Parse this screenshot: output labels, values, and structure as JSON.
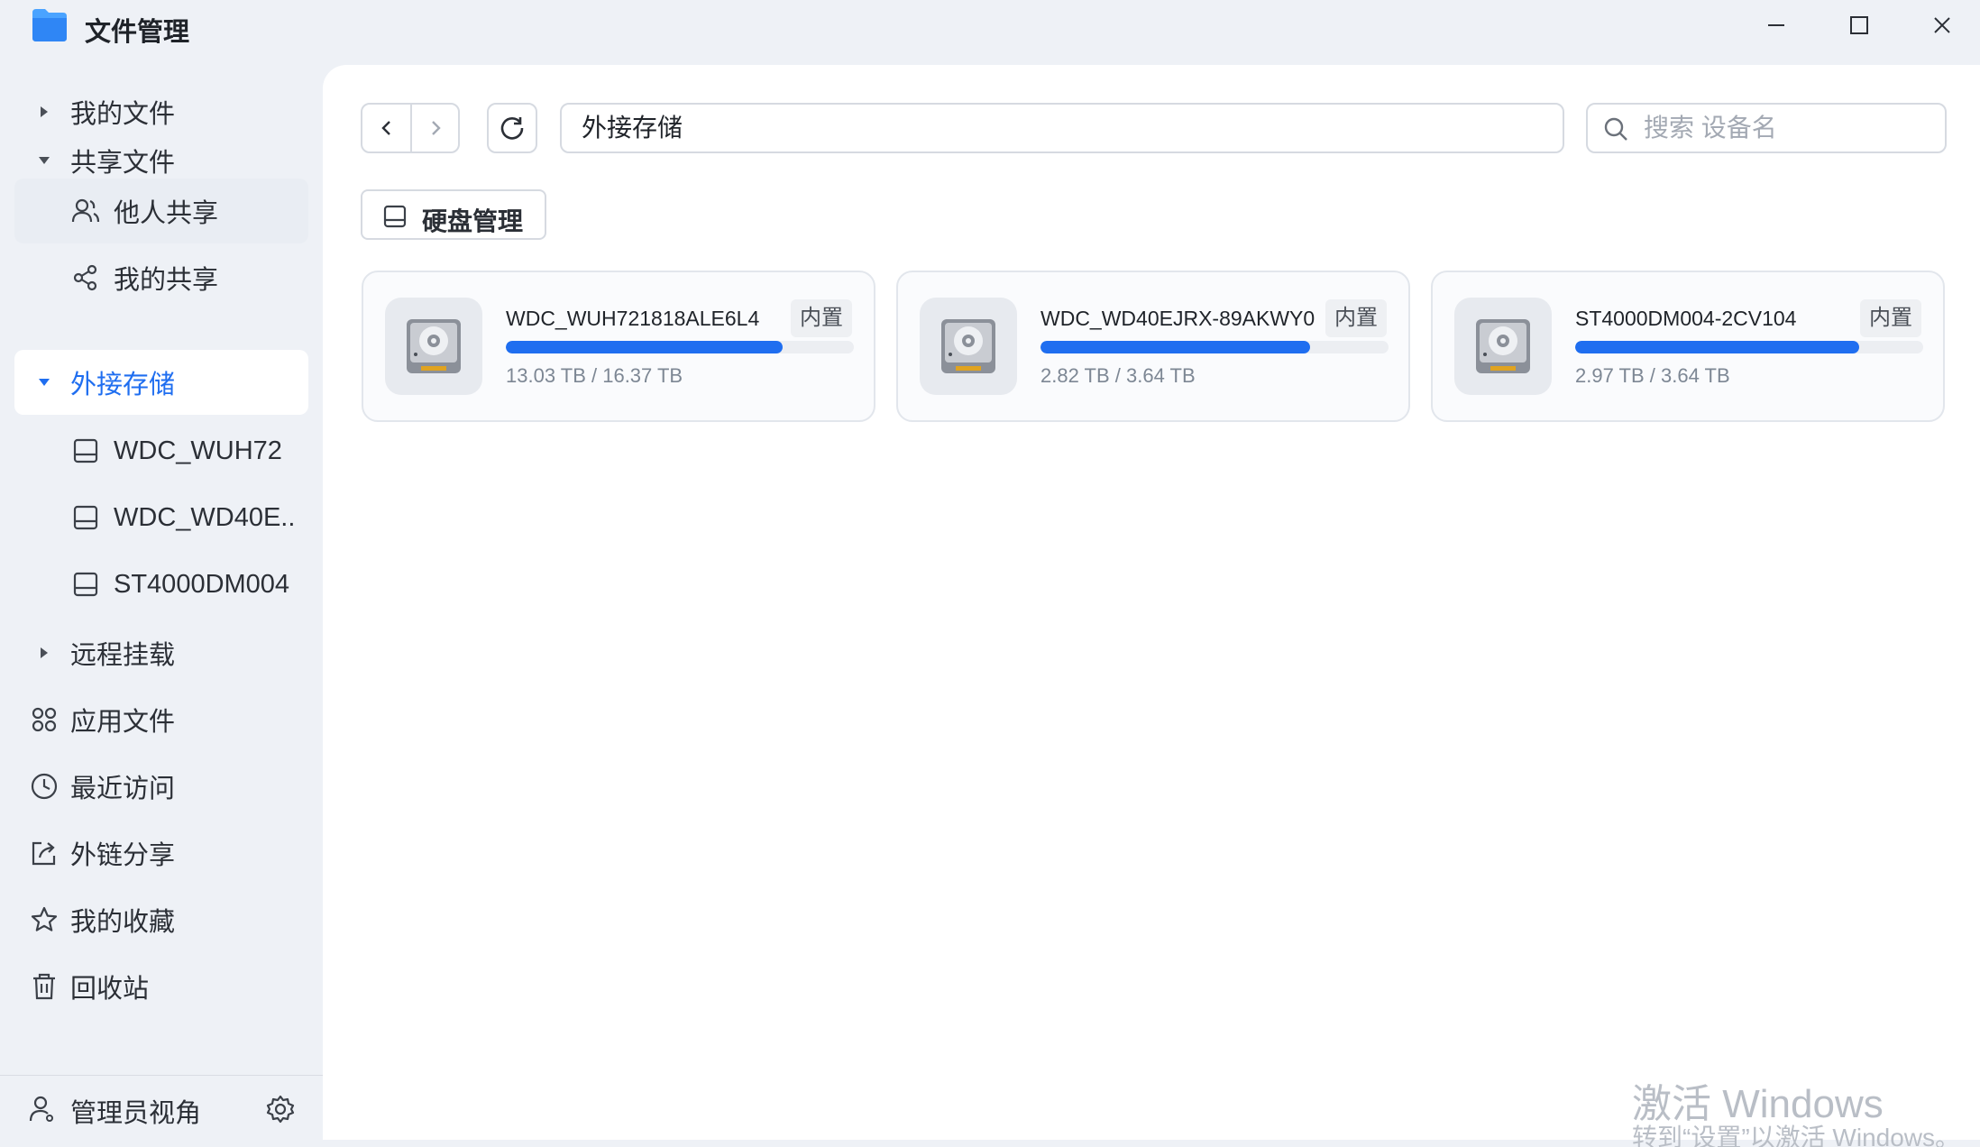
{
  "app": {
    "title": "文件管理",
    "accent": "#1f6ef0"
  },
  "window_controls": [
    "minimize-icon",
    "maximize-icon",
    "close-icon"
  ],
  "sidebar": {
    "items": [
      {
        "label": "我的文件",
        "icon": "caret-right-icon"
      },
      {
        "label": "共享文件",
        "icon": "caret-down-icon"
      },
      {
        "label": "他人共享",
        "icon": "users-icon"
      },
      {
        "label": "我的共享",
        "icon": "share-icon"
      },
      {
        "label": "外接存储",
        "icon": "caret-down-icon",
        "active": true
      },
      {
        "label": "WDC_WUH72",
        "icon": "drive-icon"
      },
      {
        "label": "WDC_WD40E...",
        "icon": "drive-icon"
      },
      {
        "label": "ST4000DM004",
        "icon": "drive-icon"
      },
      {
        "label": "远程挂载",
        "icon": "caret-right-icon"
      },
      {
        "label": "应用文件",
        "icon": "apps-icon"
      },
      {
        "label": "最近访问",
        "icon": "clock-icon"
      },
      {
        "label": "外链分享",
        "icon": "external-share-icon"
      },
      {
        "label": "我的收藏",
        "icon": "star-icon"
      },
      {
        "label": "回收站",
        "icon": "trash-icon"
      }
    ],
    "footer": {
      "label": "管理员视角",
      "icon": "user-icon",
      "action_icon": "gear-icon"
    }
  },
  "toolbar": {
    "path": "外接存储",
    "search_placeholder": "搜索 设备名",
    "disk_manage_label": "硬盘管理"
  },
  "disks": [
    {
      "name": "WDC_WUH721818ALE6L4",
      "badge": "内置",
      "usage": "13.03 TB / 16.37 TB",
      "used_fraction": 0.796
    },
    {
      "name": "WDC_WD40EJRX-89AKWY0",
      "badge": "内置",
      "usage": "2.82 TB / 3.64 TB",
      "used_fraction": 0.775
    },
    {
      "name": "ST4000DM004-2CV104",
      "badge": "内置",
      "usage": "2.97 TB / 3.64 TB",
      "used_fraction": 0.816
    }
  ],
  "watermark": {
    "line1": "激活 Windows",
    "line2": "转到“设置”以激活 Windows。"
  }
}
